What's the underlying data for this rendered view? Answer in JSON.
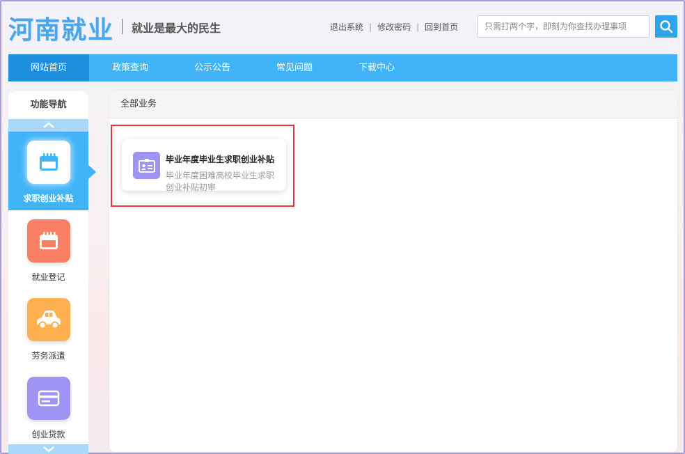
{
  "header": {
    "logo_text": "河南就业",
    "slogan": "就业是最大的民生",
    "links": [
      "退出系统",
      "修改密码",
      "回到首页"
    ],
    "search": {
      "placeholder": "只需打两个字，即刻为你查找办理事项",
      "value": ""
    }
  },
  "nav": {
    "items": [
      "网站首页",
      "政策查询",
      "公示公告",
      "常见问题",
      "下载中心"
    ],
    "active_index": 0
  },
  "sidebar": {
    "title": "功能导航",
    "items": [
      {
        "label": "求职创业补贴",
        "icon": "calendar-icon",
        "color": "#ffffff",
        "active": true
      },
      {
        "label": "就业登记",
        "icon": "calendar-icon",
        "color": "#fa8065",
        "active": false
      },
      {
        "label": "劳务派遣",
        "icon": "car-icon",
        "color": "#ffb050",
        "active": false
      },
      {
        "label": "创业贷款",
        "icon": "card-icon",
        "color": "#9f93f3",
        "active": false
      }
    ]
  },
  "main": {
    "header": "全部业务",
    "cards": [
      {
        "title": "毕业年度毕业生求职创业补贴",
        "desc": "毕业年度困难高校毕业生求职创业补贴初审",
        "icon": "id-card-icon",
        "icon_color": "#9f93f3"
      }
    ]
  },
  "colors": {
    "accent": "#41b4f7",
    "nav_active": "#1d90df",
    "logo": "#4aa6e8",
    "highlight_border": "#e0383e"
  }
}
